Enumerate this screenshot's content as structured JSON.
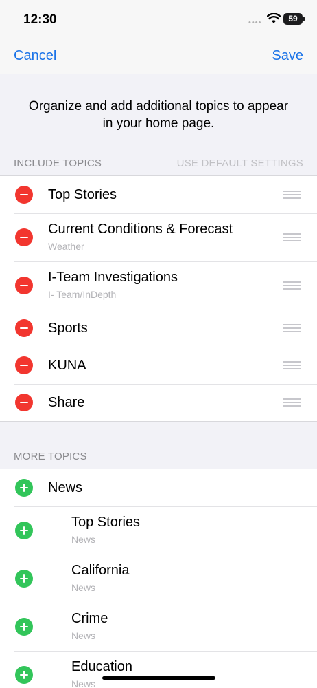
{
  "status_bar": {
    "time": "12:30",
    "battery": "59"
  },
  "nav": {
    "cancel": "Cancel",
    "save": "Save"
  },
  "intro": "Organize and add additional topics to appear in your home page.",
  "include_section": {
    "header": "INCLUDE TOPICS",
    "action": "USE DEFAULT SETTINGS",
    "items": [
      {
        "title": "Top Stories",
        "subtitle": ""
      },
      {
        "title": "Current Conditions & Forecast",
        "subtitle": "Weather"
      },
      {
        "title": "I-Team Investigations",
        "subtitle": "I- Team/InDepth"
      },
      {
        "title": "Sports",
        "subtitle": ""
      },
      {
        "title": "KUNA",
        "subtitle": ""
      },
      {
        "title": "Share",
        "subtitle": ""
      }
    ]
  },
  "more_section": {
    "header": "MORE TOPICS",
    "items": [
      {
        "title": "News",
        "subtitle": ""
      },
      {
        "title": "Top Stories",
        "subtitle": "News"
      },
      {
        "title": "California",
        "subtitle": "News"
      },
      {
        "title": "Crime",
        "subtitle": "News"
      },
      {
        "title": "Education",
        "subtitle": "News"
      }
    ]
  },
  "colors": {
    "accent": "#1a73e8",
    "remove": "#f2362f",
    "add": "#32c55a",
    "background": "#f2f2f7"
  }
}
